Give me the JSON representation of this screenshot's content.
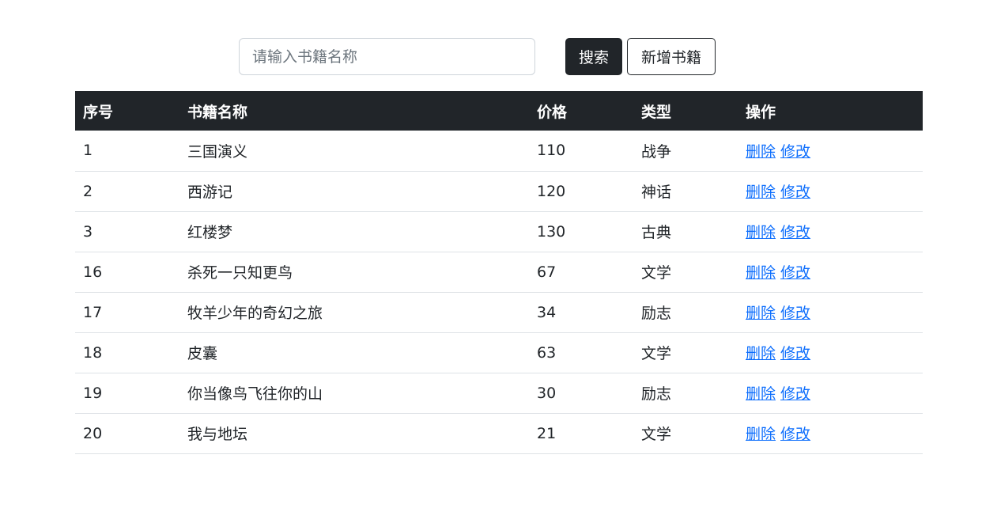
{
  "toolbar": {
    "search_placeholder": "请输入书籍名称",
    "search_value": "",
    "search_label": "搜索",
    "add_label": "新增书籍"
  },
  "table": {
    "headers": [
      "序号",
      "书籍名称",
      "价格",
      "类型",
      "操作"
    ],
    "delete_label": "删除",
    "edit_label": "修改",
    "rows": [
      {
        "id": "1",
        "name": "三国演义",
        "price": "110",
        "type": "战争"
      },
      {
        "id": "2",
        "name": "西游记",
        "price": "120",
        "type": "神话"
      },
      {
        "id": "3",
        "name": "红楼梦",
        "price": "130",
        "type": "古典"
      },
      {
        "id": "16",
        "name": "杀死一只知更鸟",
        "price": "67",
        "type": "文学"
      },
      {
        "id": "17",
        "name": "牧羊少年的奇幻之旅",
        "price": "34",
        "type": "励志"
      },
      {
        "id": "18",
        "name": "皮囊",
        "price": "63",
        "type": "文学"
      },
      {
        "id": "19",
        "name": "你当像鸟飞往你的山",
        "price": "30",
        "type": "励志"
      },
      {
        "id": "20",
        "name": "我与地坛",
        "price": "21",
        "type": "文学"
      }
    ]
  },
  "colors": {
    "header_bg": "#212529",
    "link": "#0d6efd",
    "row_border": "#dee2e6"
  }
}
